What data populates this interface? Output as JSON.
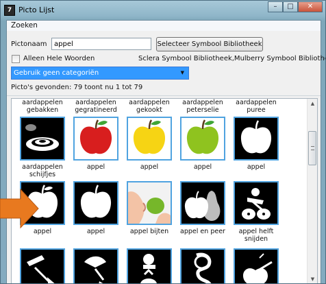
{
  "window": {
    "title": "Picto Lijst",
    "app_icon_glyph": "7",
    "controls": {
      "minimize": "–",
      "maximize": "□",
      "close": "✕"
    }
  },
  "menu": {
    "items": [
      "Zoeken"
    ]
  },
  "search": {
    "label": "Pictonaam",
    "value": "appel",
    "select_library_label": "Selecteer Symbool Bibliotheek",
    "libraries_text": "Sclera Symbool Bibliotheek,Mulberry Symbool Bibliothee"
  },
  "whole_words": {
    "label": "Alleen Hele Woorden",
    "checked": false
  },
  "category": {
    "selected": "Gebruik geen categoriën",
    "arrow_glyph": "▼"
  },
  "results": {
    "summary": "Picto's gevonden: 79 toont nu 1 tot 79"
  },
  "grid": {
    "top_captions": [
      "aardappelen gebakken",
      "aardappelen gegratineerd",
      "aardappelen gekookt",
      "aardappelen peterselie",
      "aardappelen puree"
    ],
    "rows": [
      [
        {
          "caption": "aardappelen schijfjes",
          "icon": "potato-slices-icon"
        },
        {
          "caption": "appel",
          "icon": "red-apple-icon"
        },
        {
          "caption": "appel",
          "icon": "yellow-apple-icon"
        },
        {
          "caption": "appel",
          "icon": "green-apple-icon"
        },
        {
          "caption": "appel",
          "icon": "white-apple-icon"
        }
      ],
      [
        {
          "caption": "appel",
          "icon": "white-apple-icon"
        },
        {
          "caption": "appel",
          "icon": "white-apple-outline-icon"
        },
        {
          "caption": "appel bijten",
          "icon": "bite-apple-icon"
        },
        {
          "caption": "appel en peer",
          "icon": "apple-and-pear-icon"
        },
        {
          "caption": "appel helft snijden",
          "icon": "cut-apple-icon"
        }
      ],
      [
        {
          "caption": "",
          "icon": "peel-apple-icon"
        },
        {
          "caption": "",
          "icon": "slice-apple-icon"
        },
        {
          "caption": "",
          "icon": "core-apple-icon"
        },
        {
          "caption": "",
          "icon": "apple-peel-spiral-icon"
        },
        {
          "caption": "",
          "icon": "apple-knife-icon"
        }
      ]
    ],
    "scroll_arrows": {
      "up": "▲",
      "down": "▼"
    }
  },
  "colors": {
    "selection": "#3399ff",
    "tile_border": "#4fa3e0",
    "arrow": "#e8791f",
    "red_apple": "#d81e1e",
    "yellow_apple": "#f6d414",
    "green_apple": "#8fc31f"
  }
}
